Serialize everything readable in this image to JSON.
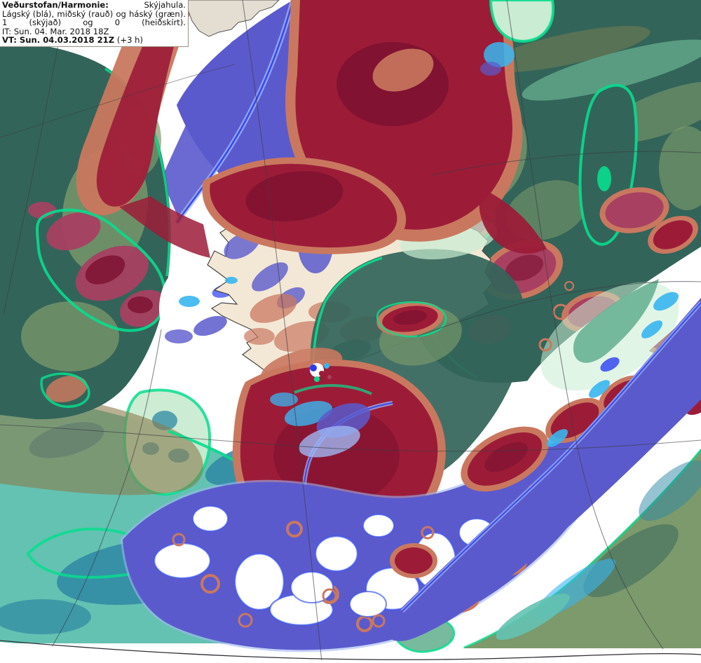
{
  "legend": {
    "source_label": "Veðurstofan/Harmonie:",
    "variable_label": "Skýjahula.",
    "layers_parts": [
      "Lágský (blá),",
      "miðský (rauð)",
      "og",
      "háský (græn)."
    ],
    "scale_parts": [
      "1",
      "(skýjað)",
      "og",
      "0",
      "(heiðskírt)."
    ],
    "init_time": "IT: Sun. 04. Mar. 2018 18Z",
    "valid_time": "VT: Sun. 04.03.2018 21Z",
    "valid_offset": "(+3 h)"
  },
  "map": {
    "region": "Iceland",
    "model": "HARMONIE",
    "variable": "cloud cover (low / mid / high)",
    "palette": {
      "slate_blue": "#5b5acd",
      "bright_blue": "#2b3df2",
      "light_blue": "#9fb6f2",
      "cyan": "#38b6f0",
      "turquoise": "#64c2b2",
      "teal_blue": "#2e87a3",
      "crimson": "#9c1c38",
      "maroon": "#7c1030",
      "salmon": "#c9785f",
      "magenta": "#a84062",
      "orange_red": "#d85232",
      "teal_green": "#336459",
      "sage": "#7c9a6c",
      "sea_green": "#69b394",
      "mint": "#08dd8e",
      "mint_light": "#c9ecd2",
      "olive": "#8b7b4c",
      "olive_dark": "#6f7b51",
      "land": "#f3e8d5",
      "coast": "#454545",
      "greenland": "#e4ded2",
      "graticule": "#3b3b42",
      "frame": "#2e2e34",
      "legend_border": "#9a9284"
    }
  }
}
